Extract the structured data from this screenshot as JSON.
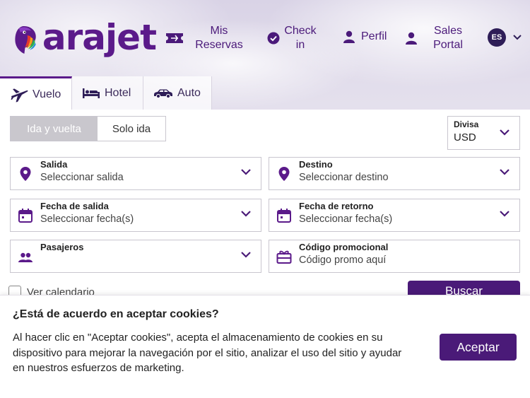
{
  "brand": {
    "name": "arajet",
    "color": "#5b1a8a"
  },
  "nav": {
    "reservas": "Mis Reservas",
    "checkin": "Check in",
    "perfil": "Perfil",
    "sales": "Sales Portal",
    "lang": "ES"
  },
  "tabs": [
    {
      "label": "Vuelo",
      "icon": "plane-icon",
      "active": true
    },
    {
      "label": "Hotel",
      "icon": "bed-icon",
      "active": false
    },
    {
      "label": "Auto",
      "icon": "car-icon",
      "active": false
    }
  ],
  "trip": {
    "roundtrip": "Ida y vuelta",
    "oneway": "Solo ida"
  },
  "currency": {
    "label": "Divisa",
    "value": "USD"
  },
  "fields": {
    "salida": {
      "label": "Salida",
      "value": "Seleccionar salida"
    },
    "destino": {
      "label": "Destino",
      "value": "Seleccionar destino"
    },
    "fecha_salida": {
      "label": "Fecha de salida",
      "value": "Seleccionar fecha(s)"
    },
    "fecha_retorno": {
      "label": "Fecha de retorno",
      "value": "Seleccionar fecha(s)"
    },
    "pasajeros": {
      "label": "Pasajeros",
      "value": ""
    },
    "promo": {
      "label": "Código promocional",
      "placeholder": "Código promo aquí"
    }
  },
  "ver_calendario": "Ver calendario",
  "buscar": "Buscar",
  "cookie": {
    "title": "¿Está de acuerdo en aceptar cookies?",
    "text": "Al hacer clic en \"Aceptar cookies\", acepta el almacenamiento de cookies en su dispositivo para mejorar la navegación por el sitio, analizar el uso del sitio y ayudar en nuestros esfuerzos de marketing.",
    "accept": "Aceptar"
  },
  "colors": {
    "primary": "#4a1a78",
    "icon": "#5b1a8a",
    "badge": "#2e1d57"
  }
}
